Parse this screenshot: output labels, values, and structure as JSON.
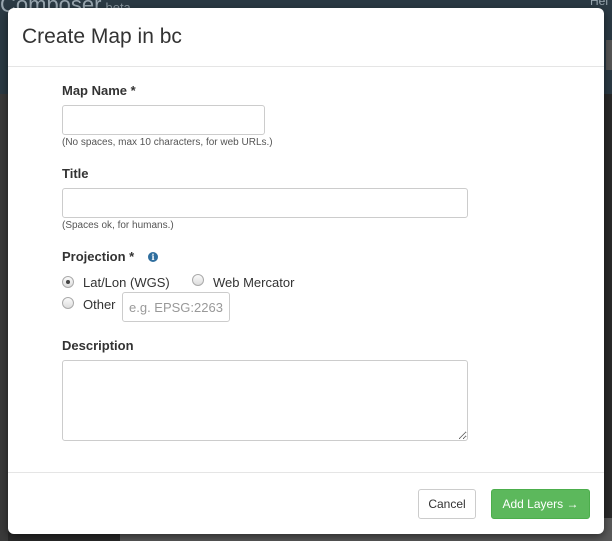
{
  "background": {
    "app_title": "Composer",
    "app_badge": "beta",
    "help_text": "Hel"
  },
  "modal": {
    "title": "Create Map in bc",
    "fields": {
      "map_name": {
        "label": "Map Name *",
        "value": "",
        "help": "(No spaces, max 10 characters, for web URLs.)"
      },
      "title": {
        "label": "Title",
        "value": "",
        "help": "(Spaces ok, for humans.)"
      },
      "projection": {
        "label": "Projection *",
        "info_icon": "info-icon",
        "options": [
          {
            "label": "Lat/Lon (WGS)",
            "checked": true
          },
          {
            "label": "Web Mercator",
            "checked": false
          },
          {
            "label": "Other",
            "checked": false
          }
        ],
        "other_placeholder": "e.g. EPSG:2263"
      },
      "description": {
        "label": "Description",
        "value": ""
      }
    },
    "footer": {
      "cancel_label": "Cancel",
      "primary_label": "Add Layers →"
    }
  },
  "colors": {
    "primary": "#5cb85c",
    "info": "#2f6e9e"
  }
}
